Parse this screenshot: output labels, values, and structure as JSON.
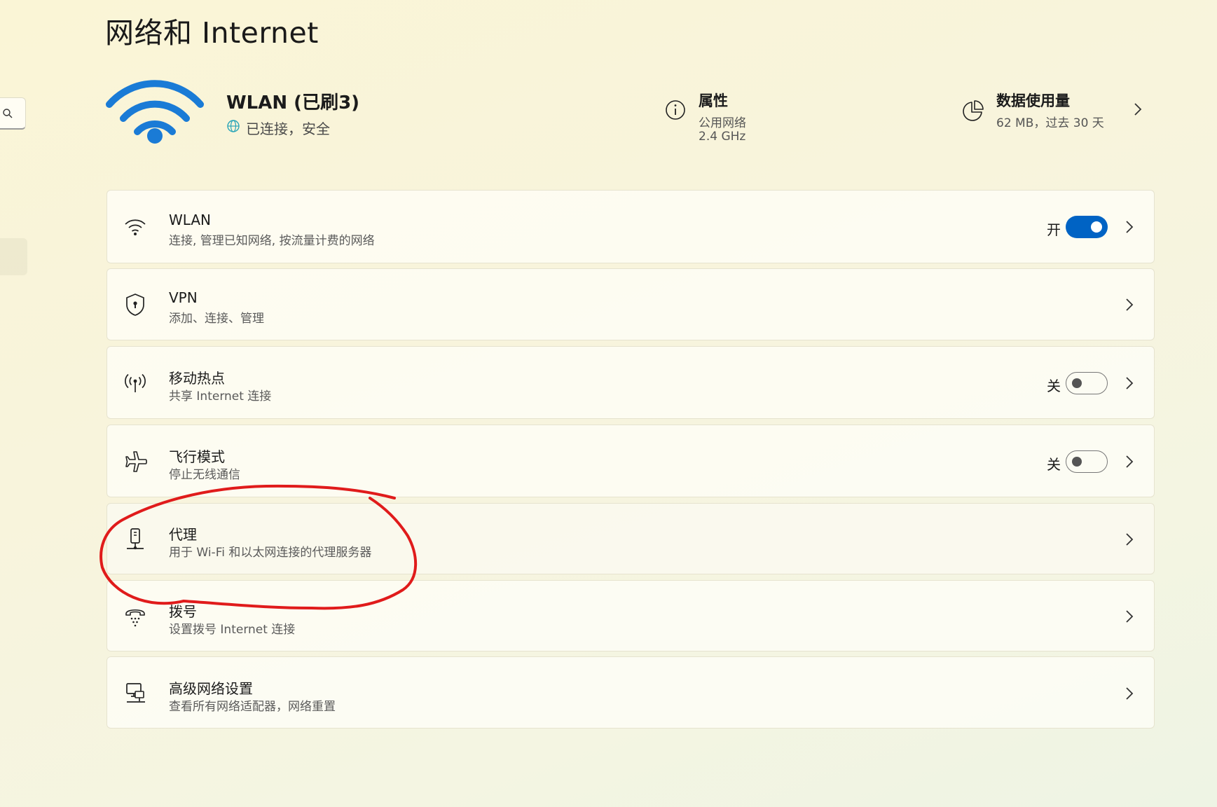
{
  "page": {
    "title": "网络和 Internet"
  },
  "connection": {
    "name": "WLAN (已刷3)",
    "status": "已连接，安全"
  },
  "properties": {
    "title": "属性",
    "line1": "公用网络",
    "line2": "2.4 GHz"
  },
  "data_usage": {
    "title": "数据使用量",
    "subtitle": "62 MB，过去 30 天"
  },
  "settings": [
    {
      "title": "WLAN",
      "subtitle": "连接, 管理已知网络, 按流量计费的网络",
      "icon": "wifi-icon",
      "state_label": "开",
      "toggle_on": true
    },
    {
      "title": "VPN",
      "subtitle": "添加、连接、管理",
      "icon": "shield-icon"
    },
    {
      "title": "移动热点",
      "subtitle": "共享 Internet 连接",
      "icon": "hotspot-icon",
      "state_label": "关",
      "toggle_on": false
    },
    {
      "title": "飞行模式",
      "subtitle": "停止无线通信",
      "icon": "airplane-icon",
      "state_label": "关",
      "toggle_on": false
    },
    {
      "title": "代理",
      "subtitle": "用于 Wi-Fi 和以太网连接的代理服务器",
      "icon": "proxy-icon"
    },
    {
      "title": "拨号",
      "subtitle": "设置拨号 Internet 连接",
      "icon": "dialup-icon"
    },
    {
      "title": "高级网络设置",
      "subtitle": "查看所有网络适配器，网络重置",
      "icon": "network-adapter-icon"
    }
  ],
  "colors": {
    "accent": "#0063c4",
    "wifi_big": "#1a7bd6",
    "annotation": "#e01b1b",
    "globe": "#2aa5b8"
  }
}
